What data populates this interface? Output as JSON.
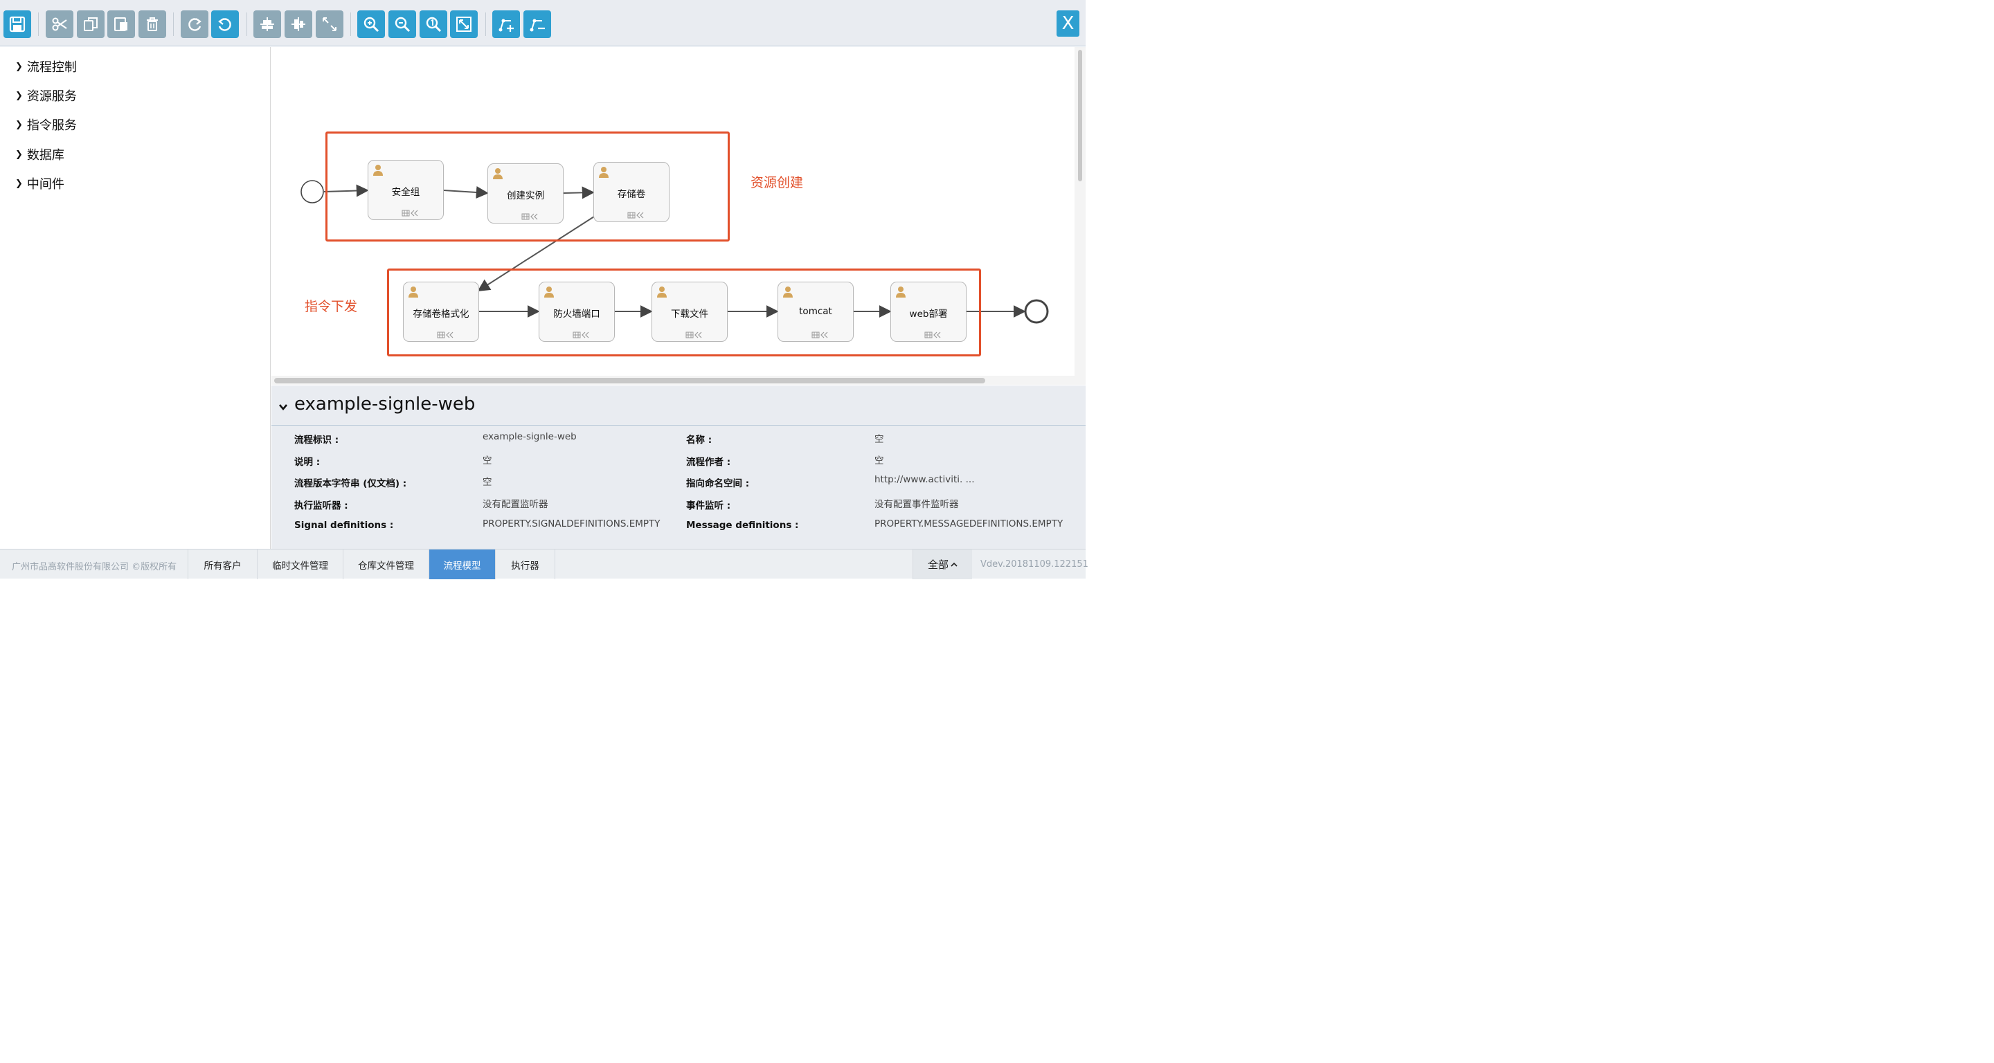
{
  "toolbar": {
    "buttons": [
      "save-icon",
      "cut-icon",
      "copy-icon",
      "paste-icon",
      "delete-icon",
      "redo-icon",
      "undo-icon",
      "align-horizontal-icon",
      "align-vertical-icon",
      "same-size-icon",
      "zoom-in-icon",
      "zoom-out-icon",
      "zoom-actual-icon",
      "zoom-fit-icon",
      "add-bendpoint-icon",
      "remove-bendpoint-icon"
    ],
    "close_label": "X"
  },
  "sidebar": {
    "items": [
      {
        "label": "流程控制"
      },
      {
        "label": "资源服务"
      },
      {
        "label": "指令服务"
      },
      {
        "label": "数据库"
      },
      {
        "label": "中间件"
      }
    ]
  },
  "diagram": {
    "group1_label": "资源创建",
    "group2_label": "指令下发",
    "tasks": [
      {
        "label": "安全组"
      },
      {
        "label": "创建实例"
      },
      {
        "label": "存储卷"
      },
      {
        "label": "存储卷格式化"
      },
      {
        "label": "防火墙端口"
      },
      {
        "label": "下载文件"
      },
      {
        "label": "tomcat"
      },
      {
        "label": "web部署"
      }
    ],
    "accent_color": "#e2502b"
  },
  "properties": {
    "title": "example-signle-web",
    "rows": [
      {
        "key": "流程标识 :",
        "value": "example-signle-web",
        "key2": "名称 :",
        "value2": "空"
      },
      {
        "key": "说明 :",
        "value": "空",
        "key2": "流程作者 :",
        "value2": "空"
      },
      {
        "key": "流程版本字符串 (仅文档) :",
        "value": "空",
        "key2": "指向命名空间 :",
        "value2": "http://www.activiti. ..."
      },
      {
        "key": "执行监听器 :",
        "value": "没有配置监听器",
        "key2": "事件监听 :",
        "value2": "没有配置事件监听器"
      },
      {
        "key": "Signal definitions :",
        "value": "PROPERTY.SIGNALDEFINITIONS.EMPTY",
        "key2": "Message definitions :",
        "value2": "PROPERTY.MESSAGEDEFINITIONS.EMPTY"
      }
    ]
  },
  "footer": {
    "copyright": "广州市品高软件股份有限公司 ©版权所有",
    "tabs": [
      {
        "label": "所有客户"
      },
      {
        "label": "临时文件管理"
      },
      {
        "label": "仓库文件管理"
      },
      {
        "label": "流程模型"
      },
      {
        "label": "执行器"
      }
    ],
    "filter_label": "全部",
    "version": "Vdev.20181109.122151"
  }
}
